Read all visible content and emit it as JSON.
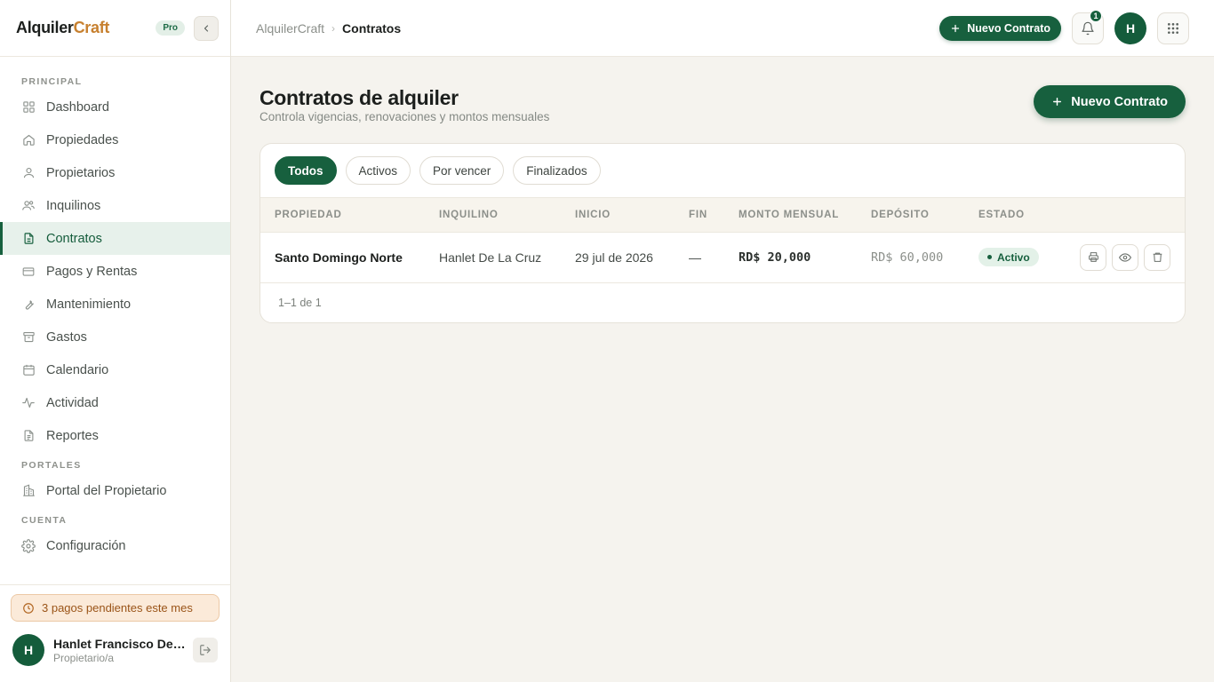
{
  "brand": {
    "name_main": "Alquiler",
    "name_accent": "Craft",
    "badge": "Pro",
    "accent_color": "#c7802f"
  },
  "sidebar": {
    "sections": {
      "principal": "PRINCIPAL",
      "portales": "PORTALES",
      "cuenta": "CUENTA"
    },
    "items": {
      "dashboard": "Dashboard",
      "propiedades": "Propiedades",
      "propietarios": "Propietarios",
      "inquilinos": "Inquilinos",
      "contratos": "Contratos",
      "pagos": "Pagos y Rentas",
      "mantenimiento": "Mantenimiento",
      "gastos": "Gastos",
      "calendario": "Calendario",
      "actividad": "Actividad",
      "reportes": "Reportes",
      "portal_propietario": "Portal del Propietario",
      "configuracion": "Configuración"
    },
    "active_item": "Contratos",
    "pending_alert": "3 pagos pendientes este mes",
    "user": {
      "initial": "H",
      "name": "Hanlet Francisco De La Cruz",
      "role": "Propietario/a"
    }
  },
  "topbar": {
    "breadcrumb_root": "AlquilerCraft",
    "breadcrumb_sep": "›",
    "breadcrumb_current": "Contratos",
    "new_contract_label": "Nuevo Contrato",
    "notification_count": "1",
    "avatar_initial": "H"
  },
  "page": {
    "title": "Contratos de alquiler",
    "subtitle": "Controla vigencias, renovaciones y montos mensuales",
    "new_contract_label": "Nuevo Contrato"
  },
  "filters": [
    "Todos",
    "Activos",
    "Por vencer",
    "Finalizados"
  ],
  "active_filter": "Todos",
  "table": {
    "columns": {
      "propiedad": "PROPIEDAD",
      "inquilino": "INQUILINO",
      "inicio": "INICIO",
      "fin": "FIN",
      "monto": "MONTO MENSUAL",
      "deposito": "DEPÓSITO",
      "estado": "ESTADO"
    },
    "rows": [
      {
        "propiedad": "Santo Domingo Norte",
        "inquilino": "Hanlet De La Cruz",
        "inicio": "29 jul de 2026",
        "fin": "—",
        "monto": "RD$ 20,000",
        "deposito": "RD$ 60,000",
        "estado": "Activo"
      }
    ],
    "pagination": "1–1 de 1"
  },
  "colors": {
    "primary": "#17603e",
    "primary_light": "#e7f1eb",
    "warning_bg": "#fbead9",
    "warning_text": "#9a5418"
  },
  "icons": [
    "dashboard-icon",
    "home-icon",
    "user-icon",
    "users-icon",
    "file-text-icon",
    "credit-card-icon",
    "wrench-icon",
    "archive-icon",
    "calendar-icon",
    "activity-icon",
    "file-icon",
    "building-icon",
    "gear-icon",
    "clock-icon",
    "logout-icon",
    "bell-icon",
    "grid-icon",
    "plus-icon",
    "chevron-left-icon",
    "printer-icon",
    "eye-icon",
    "trash-icon"
  ]
}
